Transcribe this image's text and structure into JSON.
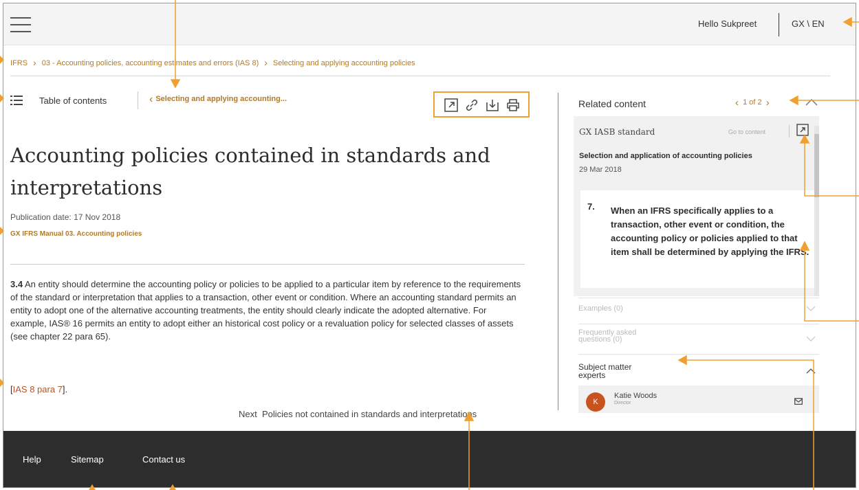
{
  "header": {
    "greeting": "Hello Sukpreet",
    "locale": "GX \\ EN",
    "menu_icon": "hamburger-menu-icon"
  },
  "breadcrumb": [
    "IFRS",
    "03 - Accounting policies, accounting estimates and errors (IAS 8)",
    "Selecting and applying accounting policies"
  ],
  "toc": {
    "icon": "list-icon",
    "label": "Table of contents",
    "back_label": "Selecting and applying accounting..."
  },
  "tools": [
    "open-external-icon",
    "link-icon",
    "download-icon",
    "print-icon"
  ],
  "article": {
    "title": "Accounting policies contained in standards and interpretations",
    "pub_date": "Publication date: 17 Nov 2018",
    "manual": "GX IFRS Manual 03. Accounting policies",
    "para_num": "3.4",
    "para_text": " An entity should determine the accounting policy or policies to be applied to a particular item by reference to the requirements of the standard or interpretation that applies to a transaction, other event or condition. Where an accounting standard permits an entity to adopt one of the alternative accounting treatments, the entity should clearly indicate the adopted alternative. For example, IAS® 16 permits an entity to adopt either an historical cost policy or a revaluation policy for selected classes of assets (see chapter 22 para 65).",
    "cite_open": "[",
    "cite_link": "IAS 8 para 7",
    "cite_close": "].",
    "next_label": "Next",
    "next_title": "Policies not contained in standards and interpretations"
  },
  "related": {
    "title": "Related content",
    "pager": "1 of 2",
    "card": {
      "label": "GX IASB standard",
      "goto": "Go to content",
      "heading": "Selection and application of accounting policies",
      "date": "29 Mar 2018",
      "quote_num": "7.",
      "quote_text": "When an IFRS specifically applies to a transaction, other event or condition, the accounting policy or policies applied to that item shall be determined by applying the IFRS."
    },
    "examples": "Examples (0)",
    "faq_line1": "Frequently asked",
    "faq_line2": "questions (0)",
    "sme_line1": "Subject matter",
    "sme_line2": "experts",
    "expert": {
      "initial": "K",
      "name": "Katie Woods",
      "role": "Director"
    }
  },
  "footer": [
    "Help",
    "Sitemap",
    "Contact us"
  ],
  "colors": {
    "accent": "#b07a2a",
    "annotation": "#f0a030",
    "footer_bg": "#2d2d2d",
    "avatar": "#c8531f"
  }
}
